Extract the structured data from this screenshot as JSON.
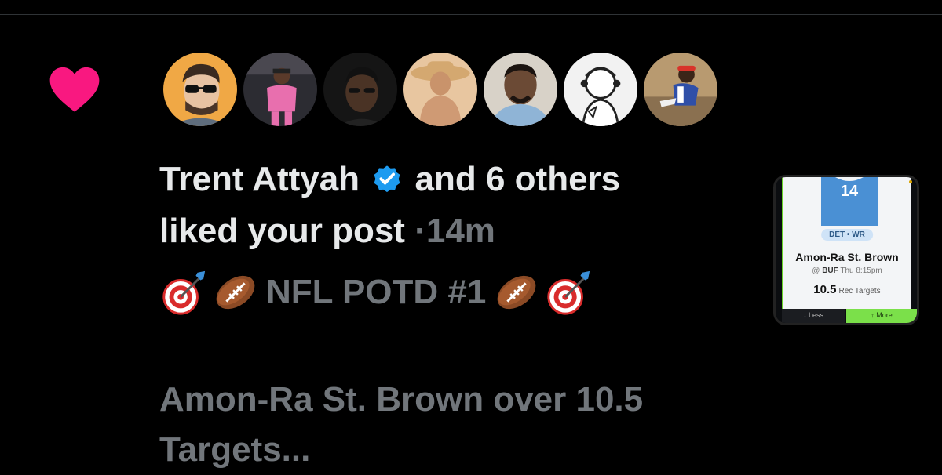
{
  "notification": {
    "type": "like",
    "liker_name": "Trent Attyah",
    "verified": true,
    "others_text": "and 6 others",
    "action_text": "liked your post",
    "separator": "·",
    "time_ago": "14m",
    "avatar_count": 7
  },
  "post": {
    "title_text": "NFL POTD #1",
    "emojis": [
      "direct-hit",
      "american-football",
      "american-football",
      "direct-hit"
    ],
    "body_text": "Amon-Ra St. Brown over 10.5 Targets..."
  },
  "card": {
    "jersey_number": "14",
    "position_badge": "DET • WR",
    "player_name": "Amon-Ra St. Brown",
    "matchup_prefix": "@",
    "opponent": "BUF",
    "game_time": "Thu 8:15pm",
    "line_value": "10.5",
    "stat_label": "Rec Targets",
    "less_label": "↓ Less",
    "more_label": "↑ More"
  },
  "colors": {
    "background": "#000000",
    "heart": "#f91880",
    "verified": "#1d9bf0",
    "primary_text": "#e7e9ea",
    "secondary_text": "#71767b",
    "card_accent": "#7be04a"
  }
}
